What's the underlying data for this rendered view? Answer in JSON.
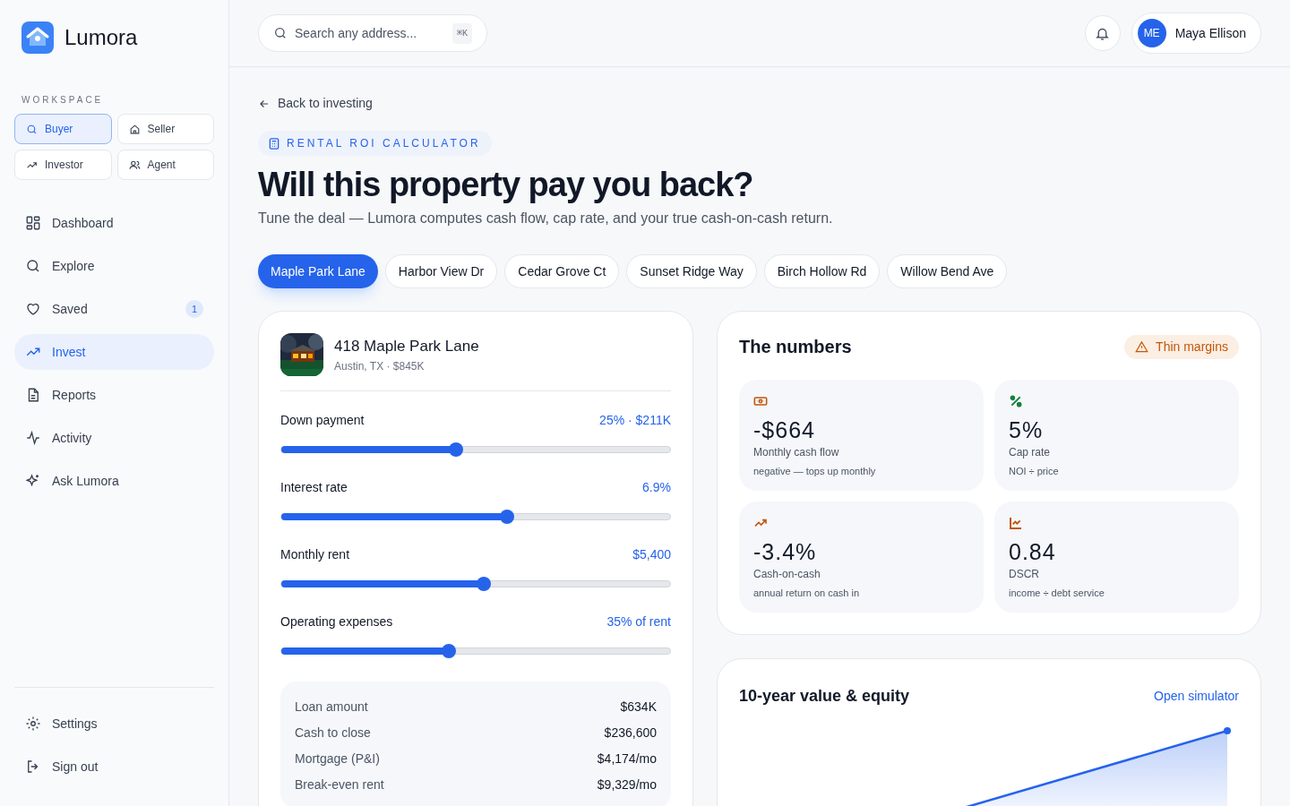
{
  "brand": "Lumora",
  "workspace": {
    "label": "WORKSPACE",
    "roles": [
      {
        "label": "Buyer",
        "selected": true
      },
      {
        "label": "Seller",
        "selected": false
      },
      {
        "label": "Investor",
        "selected": false
      },
      {
        "label": "Agent",
        "selected": false
      }
    ]
  },
  "nav": [
    {
      "label": "Dashboard",
      "selected": false
    },
    {
      "label": "Explore",
      "selected": false
    },
    {
      "label": "Saved",
      "selected": false,
      "badge": "1"
    },
    {
      "label": "Invest",
      "selected": true
    },
    {
      "label": "Reports",
      "selected": false
    },
    {
      "label": "Activity",
      "selected": false
    },
    {
      "label": "Ask Lumora",
      "selected": false
    }
  ],
  "sidebar_footer": [
    {
      "label": "Settings"
    },
    {
      "label": "Sign out"
    }
  ],
  "search": {
    "placeholder": "Search any address...",
    "shortcut": "⌘K"
  },
  "user": {
    "initials": "ME",
    "name": "Maya Ellison"
  },
  "back_link": "Back to investing",
  "eyebrow": "RENTAL ROI CALCULATOR",
  "title": "Will this property pay you back?",
  "subtitle": "Tune the deal — Lumora computes cash flow, cap rate, and your true cash-on-cash return.",
  "properties": [
    {
      "label": "Maple Park Lane",
      "selected": true
    },
    {
      "label": "Harbor View Dr",
      "selected": false
    },
    {
      "label": "Cedar Grove Ct",
      "selected": false
    },
    {
      "label": "Sunset Ridge Way",
      "selected": false
    },
    {
      "label": "Birch Hollow Rd",
      "selected": false
    },
    {
      "label": "Willow Bend Ave",
      "selected": false
    }
  ],
  "property": {
    "name": "418 Maple Park Lane",
    "meta": "Austin, TX · $845K"
  },
  "sliders": [
    {
      "label": "Down payment",
      "reading": "25% · $211K",
      "level": 0.45
    },
    {
      "label": "Interest rate",
      "reading": "6.9%",
      "level": 0.58
    },
    {
      "label": "Monthly rent",
      "reading": "$5,400",
      "level": 0.52
    },
    {
      "label": "Operating expenses",
      "reading": "35% of rent",
      "level": 0.43
    }
  ],
  "summary": [
    {
      "label": "Loan amount",
      "value": "$634K"
    },
    {
      "label": "Cash to close",
      "value": "$236,600"
    },
    {
      "label": "Mortgage (P&I)",
      "value": "$4,174/mo"
    },
    {
      "label": "Break-even rent",
      "value": "$9,329/mo"
    }
  ],
  "numbers": {
    "title": "The numbers",
    "badge": "Thin margins",
    "metrics": [
      {
        "value": "-$664",
        "label": "Monthly cash flow",
        "note": "negative — tops up monthly",
        "color": "#c2570c"
      },
      {
        "value": "5%",
        "label": "Cap rate",
        "note": "NOI ÷ price",
        "color": "#15803d"
      },
      {
        "value": "-3.4%",
        "label": "Cash-on-cash",
        "note": "annual return on cash in",
        "color": "#c2570c"
      },
      {
        "value": "0.84",
        "label": "DSCR",
        "note": "income ÷ debt service",
        "color": "#c2570c"
      }
    ]
  },
  "equity": {
    "title": "10-year value & equity",
    "link": "Open simulator"
  }
}
